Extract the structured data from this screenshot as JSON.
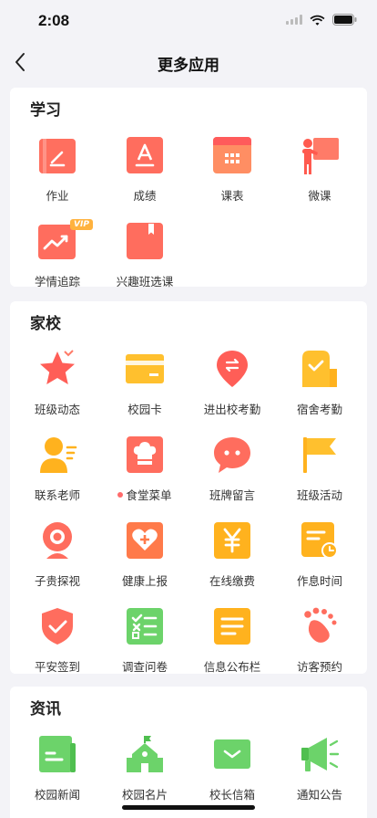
{
  "status": {
    "time": "2:08"
  },
  "nav": {
    "title": "更多应用"
  },
  "sections": [
    {
      "title": "学习",
      "items": [
        {
          "label": "作业",
          "icon": "homework-icon"
        },
        {
          "label": "成绩",
          "icon": "grade-icon"
        },
        {
          "label": "课表",
          "icon": "schedule-icon"
        },
        {
          "label": "微课",
          "icon": "micro-lesson-icon"
        },
        {
          "label": "学情追踪",
          "icon": "learning-trend-icon",
          "badge": "VIP"
        },
        {
          "label": "兴趣班选课",
          "icon": "interest-class-icon"
        }
      ]
    },
    {
      "title": "家校",
      "items": [
        {
          "label": "班级动态",
          "icon": "star-icon"
        },
        {
          "label": "校园卡",
          "icon": "campus-card-icon"
        },
        {
          "label": "进出校考勤",
          "icon": "location-icon"
        },
        {
          "label": "宿舍考勤",
          "icon": "dorm-icon"
        },
        {
          "label": "联系老师",
          "icon": "teacher-icon"
        },
        {
          "label": "食堂菜单",
          "icon": "chef-hat-icon",
          "dot": true
        },
        {
          "label": "班牌留言",
          "icon": "chat-bubble-icon"
        },
        {
          "label": "班级活动",
          "icon": "flag-icon"
        },
        {
          "label": "子贵探视",
          "icon": "webcam-icon"
        },
        {
          "label": "健康上报",
          "icon": "health-report-icon"
        },
        {
          "label": "在线缴费",
          "icon": "yuan-payment-icon"
        },
        {
          "label": "作息时间",
          "icon": "timetable-clock-icon"
        },
        {
          "label": "平安签到",
          "icon": "shield-check-icon"
        },
        {
          "label": "调查问卷",
          "icon": "survey-icon"
        },
        {
          "label": "信息公布栏",
          "icon": "bulletin-icon"
        },
        {
          "label": "访客预约",
          "icon": "footprint-icon"
        }
      ]
    },
    {
      "title": "资讯",
      "items": [
        {
          "label": "校园新闻",
          "icon": "news-icon"
        },
        {
          "label": "校园名片",
          "icon": "school-building-icon"
        },
        {
          "label": "校长信箱",
          "icon": "mailbox-icon"
        },
        {
          "label": "通知公告",
          "icon": "megaphone-icon"
        }
      ]
    }
  ]
}
